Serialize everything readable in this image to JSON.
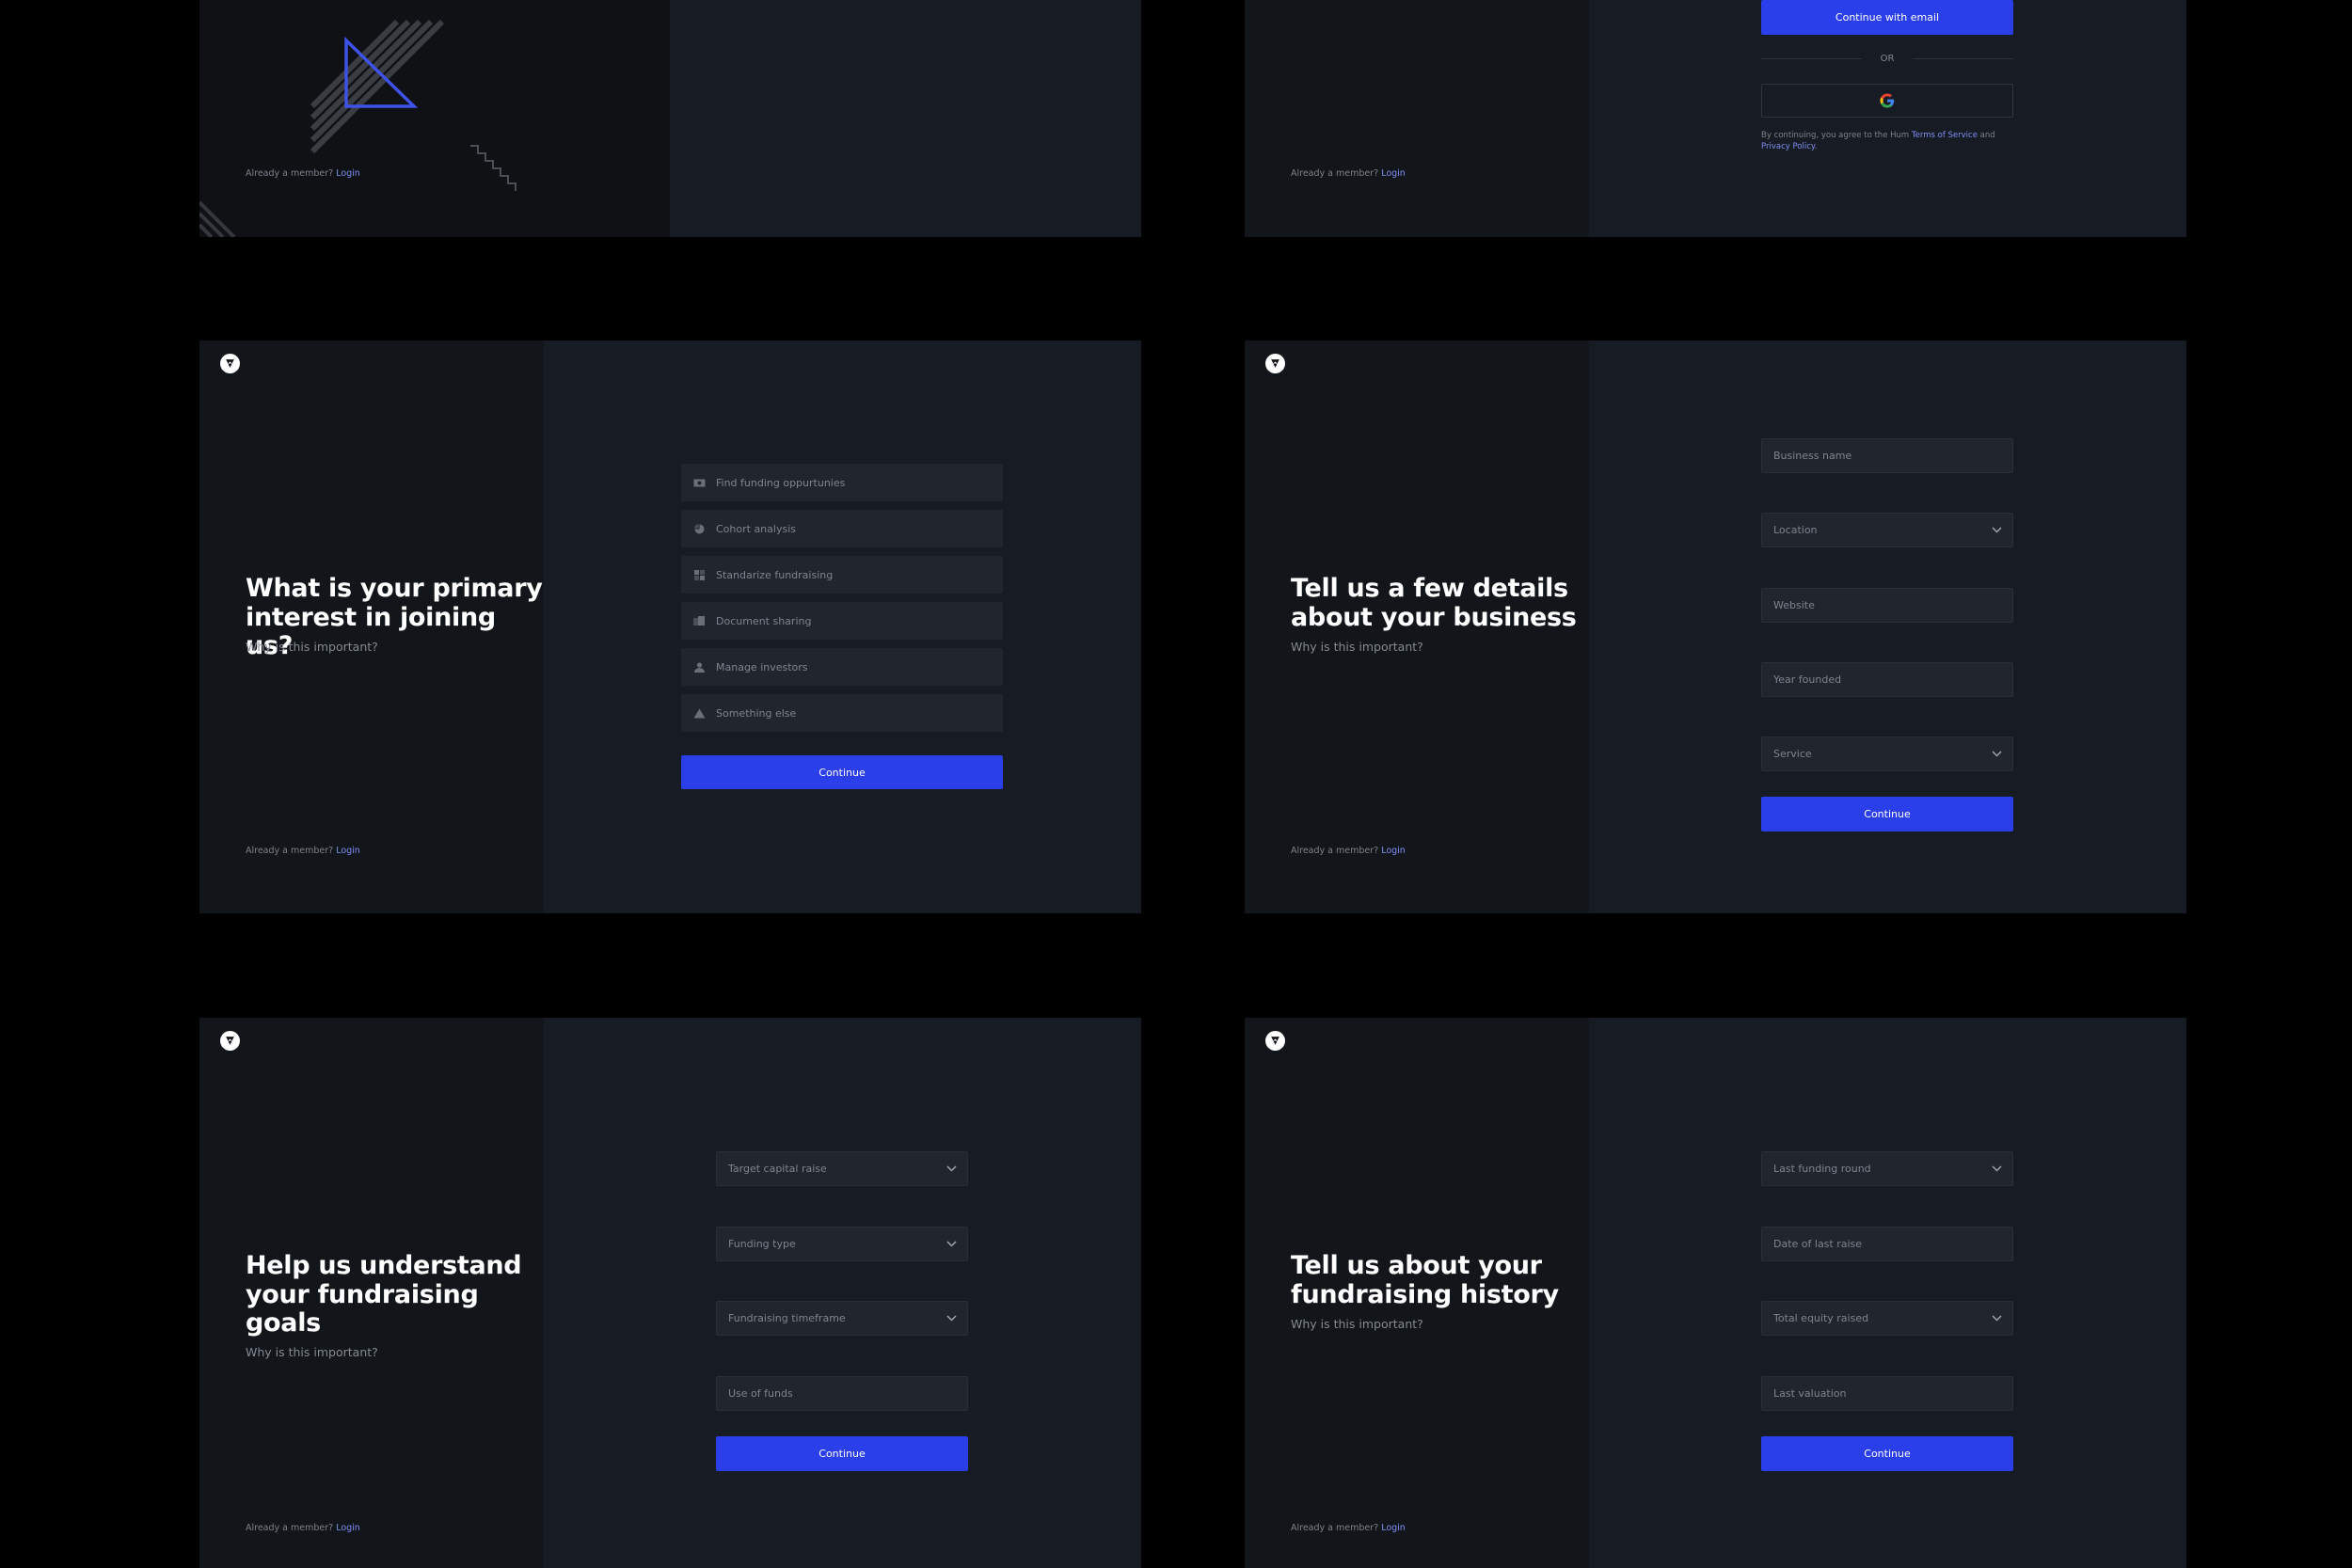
{
  "common": {
    "why_text": "Why is this important?",
    "already_member": "Already a member?",
    "login_link": "Login",
    "continue_label": "Continue"
  },
  "signup": {
    "continue_email": "Continue with email",
    "or_text": "OR",
    "terms_prefix": "By continuing, you agree to the Hum",
    "terms_link": "Terms of Service",
    "terms_and": "and",
    "privacy_link": "Privacy Policy",
    "terms_suffix": "."
  },
  "interest": {
    "title_line1": "What is your primary",
    "title_line2": "interest in joining us?",
    "options": [
      {
        "label": "Find funding oppurtunies",
        "icon": "money-icon"
      },
      {
        "label": "Cohort analysis",
        "icon": "pie-chart-icon"
      },
      {
        "label": "Standarize fundraising",
        "icon": "grid-icon"
      },
      {
        "label": "Document sharing",
        "icon": "document-icon"
      },
      {
        "label": "Manage investors",
        "icon": "person-icon"
      },
      {
        "label": "Something else",
        "icon": "triangle-icon"
      }
    ]
  },
  "business": {
    "title_line1": "Tell us a few details",
    "title_line2": "about your business",
    "fields": {
      "business_name": "Business name",
      "location": "Location",
      "website": "Website",
      "year_founded": "Year founded",
      "service": "Service"
    }
  },
  "goals": {
    "title_line1": "Help us understand",
    "title_line2": "your fundraising",
    "title_line3": "goals",
    "fields": {
      "target_capital": "Target capital raise",
      "funding_type": "Funding type",
      "timeframe": "Fundraising timeframe",
      "use_of_funds": "Use of funds"
    }
  },
  "history": {
    "title_line1": "Tell us about your",
    "title_line2": "fundraising history",
    "fields": {
      "last_round": "Last funding round",
      "date_last_raise": "Date of last raise",
      "total_equity": "Total equity raised",
      "last_valuation": "Last valuation"
    }
  },
  "colors": {
    "accent": "#2a3fe9",
    "link": "#7f8ff4",
    "panel_left": "#121519",
    "panel_right": "#171b23",
    "field_bg": "#21252d"
  }
}
